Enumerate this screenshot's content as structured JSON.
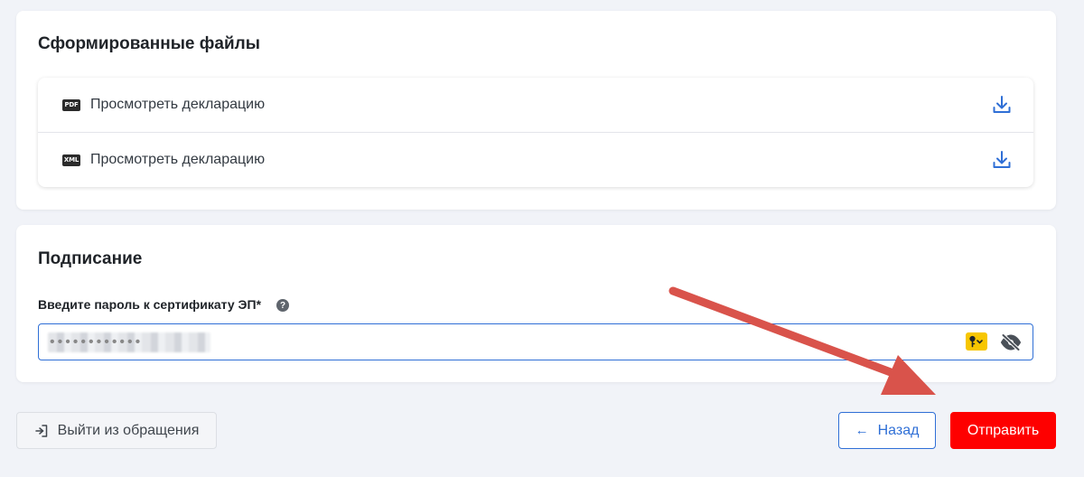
{
  "files_section": {
    "title": "Сформированные файлы",
    "files": [
      {
        "type_badge": "PDF",
        "label": "Просмотреть декларацию",
        "icon": "download-icon"
      },
      {
        "type_badge": "XML",
        "label": "Просмотреть декларацию",
        "icon": "download-icon"
      }
    ]
  },
  "sign_section": {
    "title": "Подписание",
    "password_label": "Введите пароль к сертификату ЭП*",
    "help_icon_glyph": "?",
    "password_value": "••••••••••••"
  },
  "footer": {
    "exit_label": "Выйти из обращения",
    "back_label": "Назад",
    "back_arrow": "←",
    "send_label": "Отправить"
  },
  "colors": {
    "accent_blue": "#2f6fd6",
    "send_red": "#fe0000",
    "annotation_arrow": "#d9534b",
    "key_badge": "#f7c600"
  }
}
